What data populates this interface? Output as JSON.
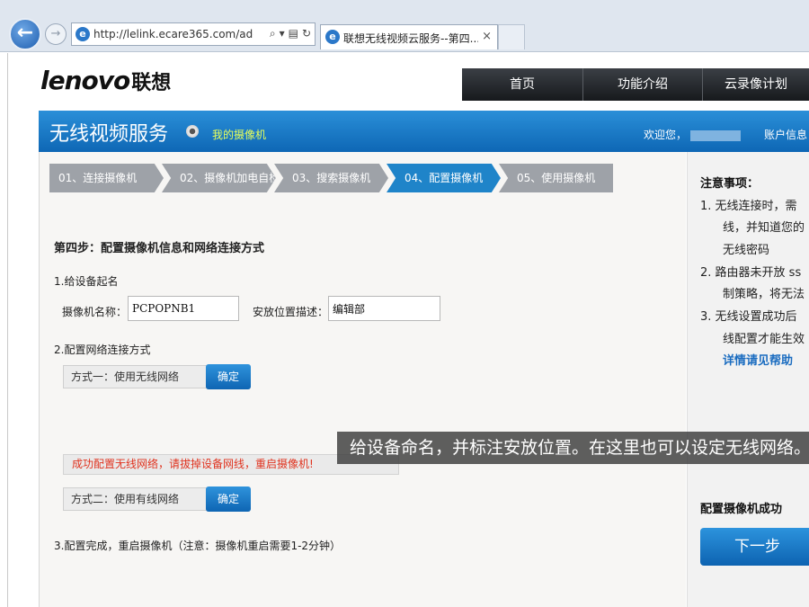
{
  "browser": {
    "url": "http://lelink.ecare365.com/add",
    "tab_title": "联想无线视频云服务--第四...",
    "tab_close": "×",
    "back": "←",
    "forward": "→",
    "favicon": "e",
    "addr_icons": [
      "⌕",
      "▾",
      "▤",
      "↻"
    ]
  },
  "header": {
    "logo_en": "lenovo",
    "logo_cn": "联想",
    "nav": [
      "首页",
      "功能介绍",
      "云录像计划"
    ]
  },
  "banner": {
    "title": "无线视频服务",
    "my_camera": "我的摄像机",
    "welcome": "欢迎您，",
    "account": "账户信息"
  },
  "steps": [
    {
      "label": "01、连接摄像机",
      "active": false
    },
    {
      "label": "02、摄像机加电自检",
      "active": false
    },
    {
      "label": "03、搜索摄像机",
      "active": false
    },
    {
      "label": "04、配置摄像机",
      "active": true
    },
    {
      "label": "05、使用摄像机",
      "active": false
    }
  ],
  "main": {
    "step_title": "第四步：配置摄像机信息和网络连接方式",
    "section1": "1.给设备起名",
    "camera_name_label": "摄像机名称：",
    "camera_name_value": "PCPOPNB1",
    "location_label": "安放位置描述：",
    "location_value": "编辑部",
    "section2": "2.配置网络连接方式",
    "method1": "方式一：使用无线网络",
    "method1_btn": "确定",
    "success_msg": "成功配置无线网络，请拔掉设备网线，重启摄像机!",
    "method2": "方式二：使用有线网络",
    "method2_btn": "确定",
    "section3": "3.配置完成，重启摄像机（注意：摄像机重启需要1-2分钟）"
  },
  "sidebar": {
    "notice_title": "注意事项：",
    "lines": [
      "1.  无线连接时，需",
      "线，并知道您的",
      "无线密码",
      "2.  路由器未开放 ss",
      "制策略，将无法",
      "3.  无线设置成功后",
      "线配置才能生效"
    ],
    "help_link": "详情请见帮助",
    "done_title": "配置摄像机成功",
    "next_btn": "下一步"
  },
  "subtitle": "给设备命名，并标注安放位置。在这里也可以设定无线网络。",
  "colors": {
    "accent": "#1f84c9",
    "error": "#e0331f",
    "link": "#1a6cc0"
  }
}
